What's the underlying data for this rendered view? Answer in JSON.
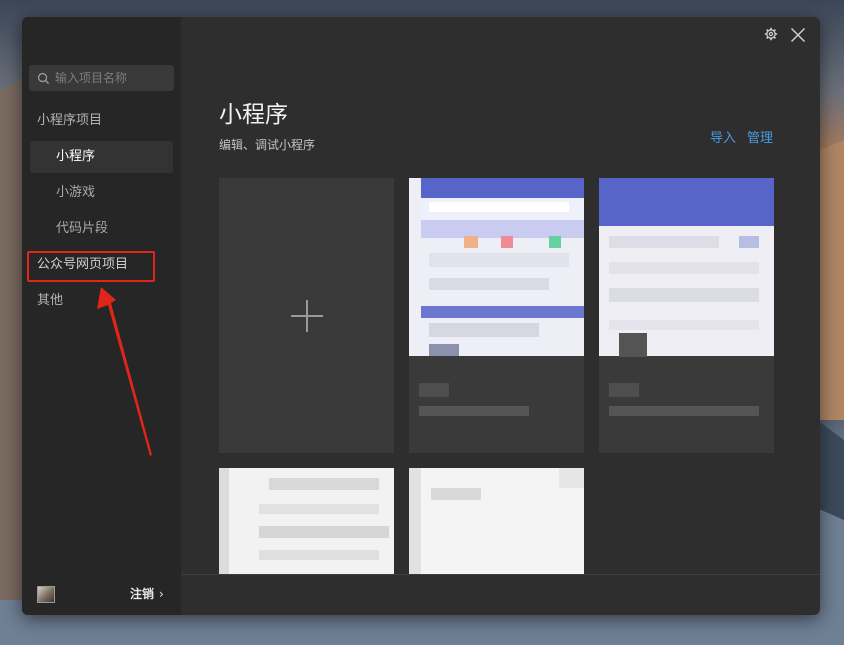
{
  "sidebar": {
    "search_placeholder": "输入项目名称",
    "section_miniprogram": "小程序项目",
    "items": [
      {
        "label": "小程序",
        "active": true
      },
      {
        "label": "小游戏",
        "active": false
      },
      {
        "label": "代码片段",
        "active": false
      }
    ],
    "official_account": "公众号网页项目",
    "other": "其他",
    "logout": "注销",
    "logout_chevron": "›"
  },
  "main": {
    "title": "小程序",
    "subtitle": "编辑、调试小程序",
    "import_label": "导入",
    "manage_label": "管理"
  },
  "colors": {
    "accent_link": "#4a9ae0",
    "highlight_red": "#e0251b",
    "window_bg": "#2e2e2e",
    "sidebar_bg": "#262626"
  },
  "icons": [
    "search-icon",
    "settings-icon",
    "close-icon",
    "plus-icon",
    "chevron-right-icon",
    "annotation-arrow"
  ]
}
